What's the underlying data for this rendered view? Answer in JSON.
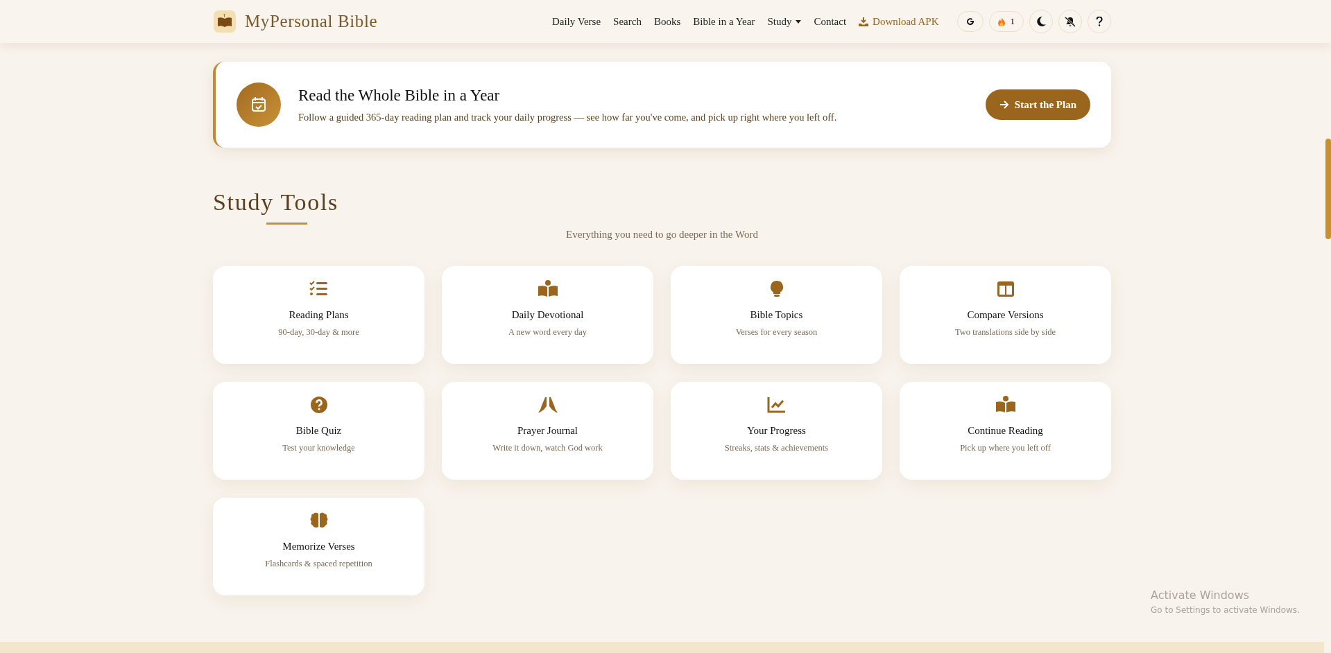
{
  "header": {
    "brand": "MyPersonal Bible",
    "nav": [
      {
        "label": "Daily Verse",
        "kind": "link"
      },
      {
        "label": "Search",
        "kind": "link"
      },
      {
        "label": "Books",
        "kind": "link"
      },
      {
        "label": "Bible in a Year",
        "kind": "link"
      },
      {
        "label": "Study",
        "kind": "dropdown"
      },
      {
        "label": "Contact",
        "kind": "link"
      },
      {
        "label": "Download APK",
        "kind": "download"
      }
    ],
    "streak": "1"
  },
  "banner": {
    "title": "Read the Whole Bible in a Year",
    "text": "Follow a guided 365-day reading plan and track your daily progress — see how far you've come, and pick up right where you left off.",
    "button": "Start the Plan"
  },
  "section": {
    "title": "Study Tools",
    "subtitle": "Everything you need to go deeper in the Word"
  },
  "tools": [
    {
      "title": "Reading Plans",
      "subtitle": "90-day, 30-day & more"
    },
    {
      "title": "Daily Devotional",
      "subtitle": "A new word every day"
    },
    {
      "title": "Bible Topics",
      "subtitle": "Verses for every season"
    },
    {
      "title": "Compare Versions",
      "subtitle": "Two translations side by side"
    },
    {
      "title": "Bible Quiz",
      "subtitle": "Test your knowledge"
    },
    {
      "title": "Prayer Journal",
      "subtitle": "Write it down, watch God work"
    },
    {
      "title": "Your Progress",
      "subtitle": "Streaks, stats & achievements"
    },
    {
      "title": "Continue Reading",
      "subtitle": "Pick up where you left off"
    },
    {
      "title": "Memorize Verses",
      "subtitle": "Flashcards & spaced repetition"
    }
  ],
  "os_notice": {
    "title": "Activate Windows",
    "text": "Go to Settings to activate Windows."
  }
}
